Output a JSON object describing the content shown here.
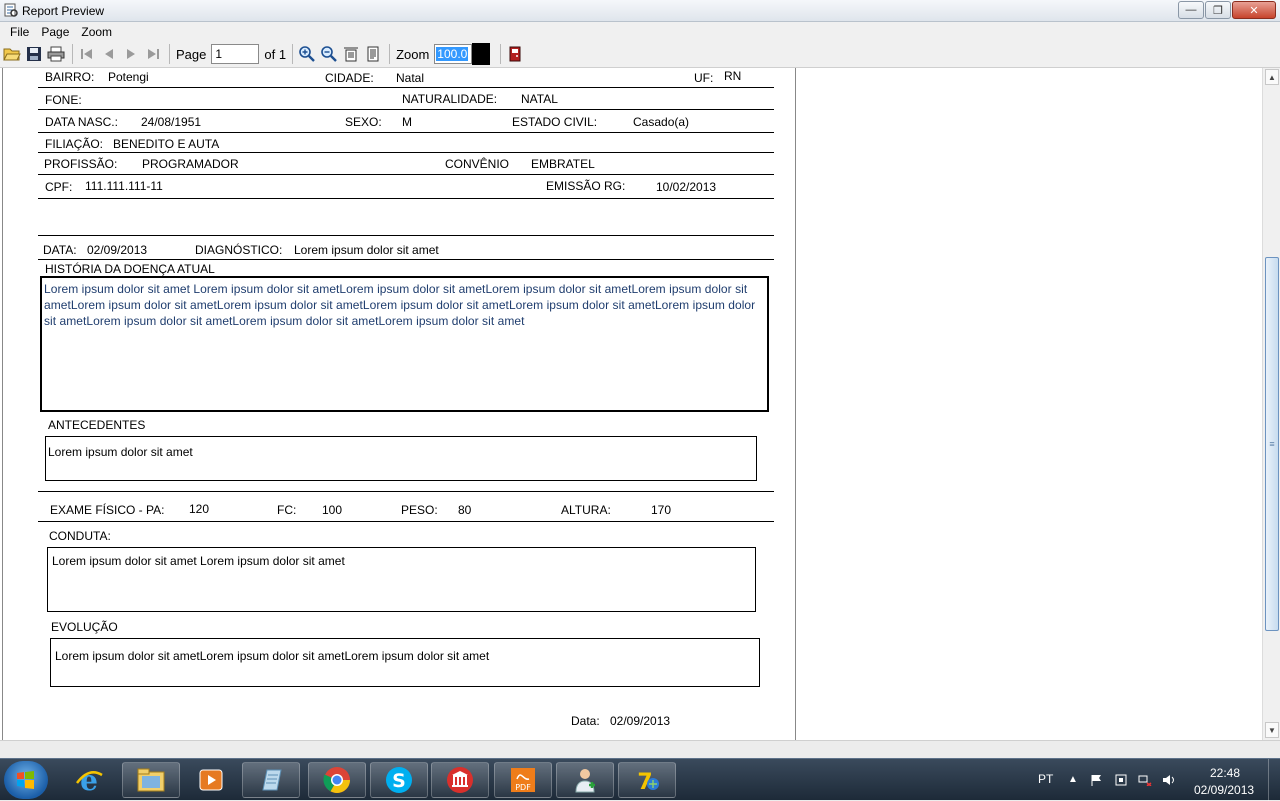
{
  "window": {
    "title": "Report Preview",
    "min_label": "—",
    "max_label": "❐",
    "close_label": "✕"
  },
  "menu": [
    "File",
    "Page",
    "Zoom"
  ],
  "toolbar": {
    "page_label": "Page",
    "page_value": "1",
    "of_label": "of 1",
    "zoom_label": "Zoom",
    "zoom_value": "100.0"
  },
  "report": {
    "bairro_label": "BAIRRO:",
    "bairro_value": "Potengi",
    "cidade_label": "CIDADE:",
    "cidade_value": "Natal",
    "uf_label": "UF:",
    "uf_value": "RN",
    "fone_label": "FONE:",
    "naturalidade_label": "NATURALIDADE:",
    "naturalidade_value": "NATAL",
    "nasc_label": "DATA NASC.:",
    "nasc_value": "24/08/1951",
    "sexo_label": "SEXO:",
    "sexo_value": "M",
    "estado_civil_label": "ESTADO  CIVIL:",
    "estado_civil_value": "Casado(a)",
    "filiacao_label": "FILIAÇÃO:",
    "filiacao_value": "BENEDITO E AUTA",
    "profissao_label": "PROFISSÃO:",
    "profissao_value": "PROGRAMADOR",
    "convenio_label": "CONVÊNIO",
    "convenio_value": "EMBRATEL",
    "cpf_label": "CPF:",
    "cpf_value": "111.111.111-11",
    "emissao_label": "EMISSÃO RG:",
    "emissao_value": "10/02/2013",
    "data_label": "DATA:",
    "data_value": "02/09/2013",
    "diagnostico_label": "DIAGNÓSTICO:",
    "diagnostico_value": "Lorem ipsum dolor sit amet",
    "historia_label": "HISTÓRIA DA DOENÇA ATUAL",
    "historia_text": "Lorem ipsum dolor sit amet Lorem ipsum dolor sit ametLorem ipsum dolor sit ametLorem ipsum dolor sit ametLorem ipsum dolor sit ametLorem ipsum dolor sit ametLorem ipsum dolor sit ametLorem ipsum dolor sit ametLorem ipsum dolor sit ametLorem ipsum dolor sit ametLorem ipsum dolor sit ametLorem ipsum dolor sit ametLorem ipsum dolor sit amet",
    "antecedentes_label": "ANTECEDENTES",
    "antecedentes_text": "Lorem ipsum dolor sit amet",
    "exame_label": "EXAME FÍSICO - PA:",
    "pa_value": "120",
    "fc_label": "FC:",
    "fc_value": "100",
    "peso_label": "PESO:",
    "peso_value": "80",
    "altura_label": "ALTURA:",
    "altura_value": "170",
    "conduta_label": "CONDUTA:",
    "conduta_text": "Lorem ipsum dolor sit amet Lorem ipsum dolor sit amet",
    "evolucao_label": "EVOLUÇÃO",
    "evolucao_text": "Lorem ipsum dolor sit ametLorem ipsum dolor sit ametLorem ipsum dolor sit amet",
    "footer_data_label": "Data:",
    "footer_data_value": "02/09/2013"
  },
  "taskbar": {
    "lang": "PT",
    "time": "22:48",
    "date": "02/09/2013",
    "apps": [
      "internet-explorer",
      "file-explorer",
      "media-player",
      "notepad-app",
      "chrome",
      "skype",
      "bank-app",
      "pdf-app",
      "medical-app",
      "7zip-app"
    ]
  }
}
